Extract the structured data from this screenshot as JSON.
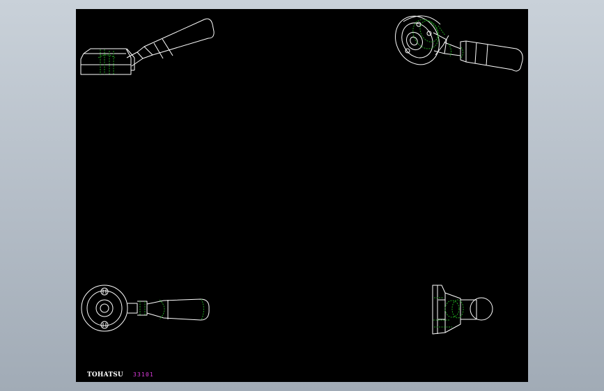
{
  "title_block": {
    "brand": "TOHATSU",
    "part_number": "33101"
  },
  "colors": {
    "background": "#b8c0c9",
    "viewport": "#000000",
    "outline": "#ffffff",
    "hidden_line": "#1fa51f",
    "brand_text": "#ffffff",
    "part_number_text": "#e03ce0"
  }
}
